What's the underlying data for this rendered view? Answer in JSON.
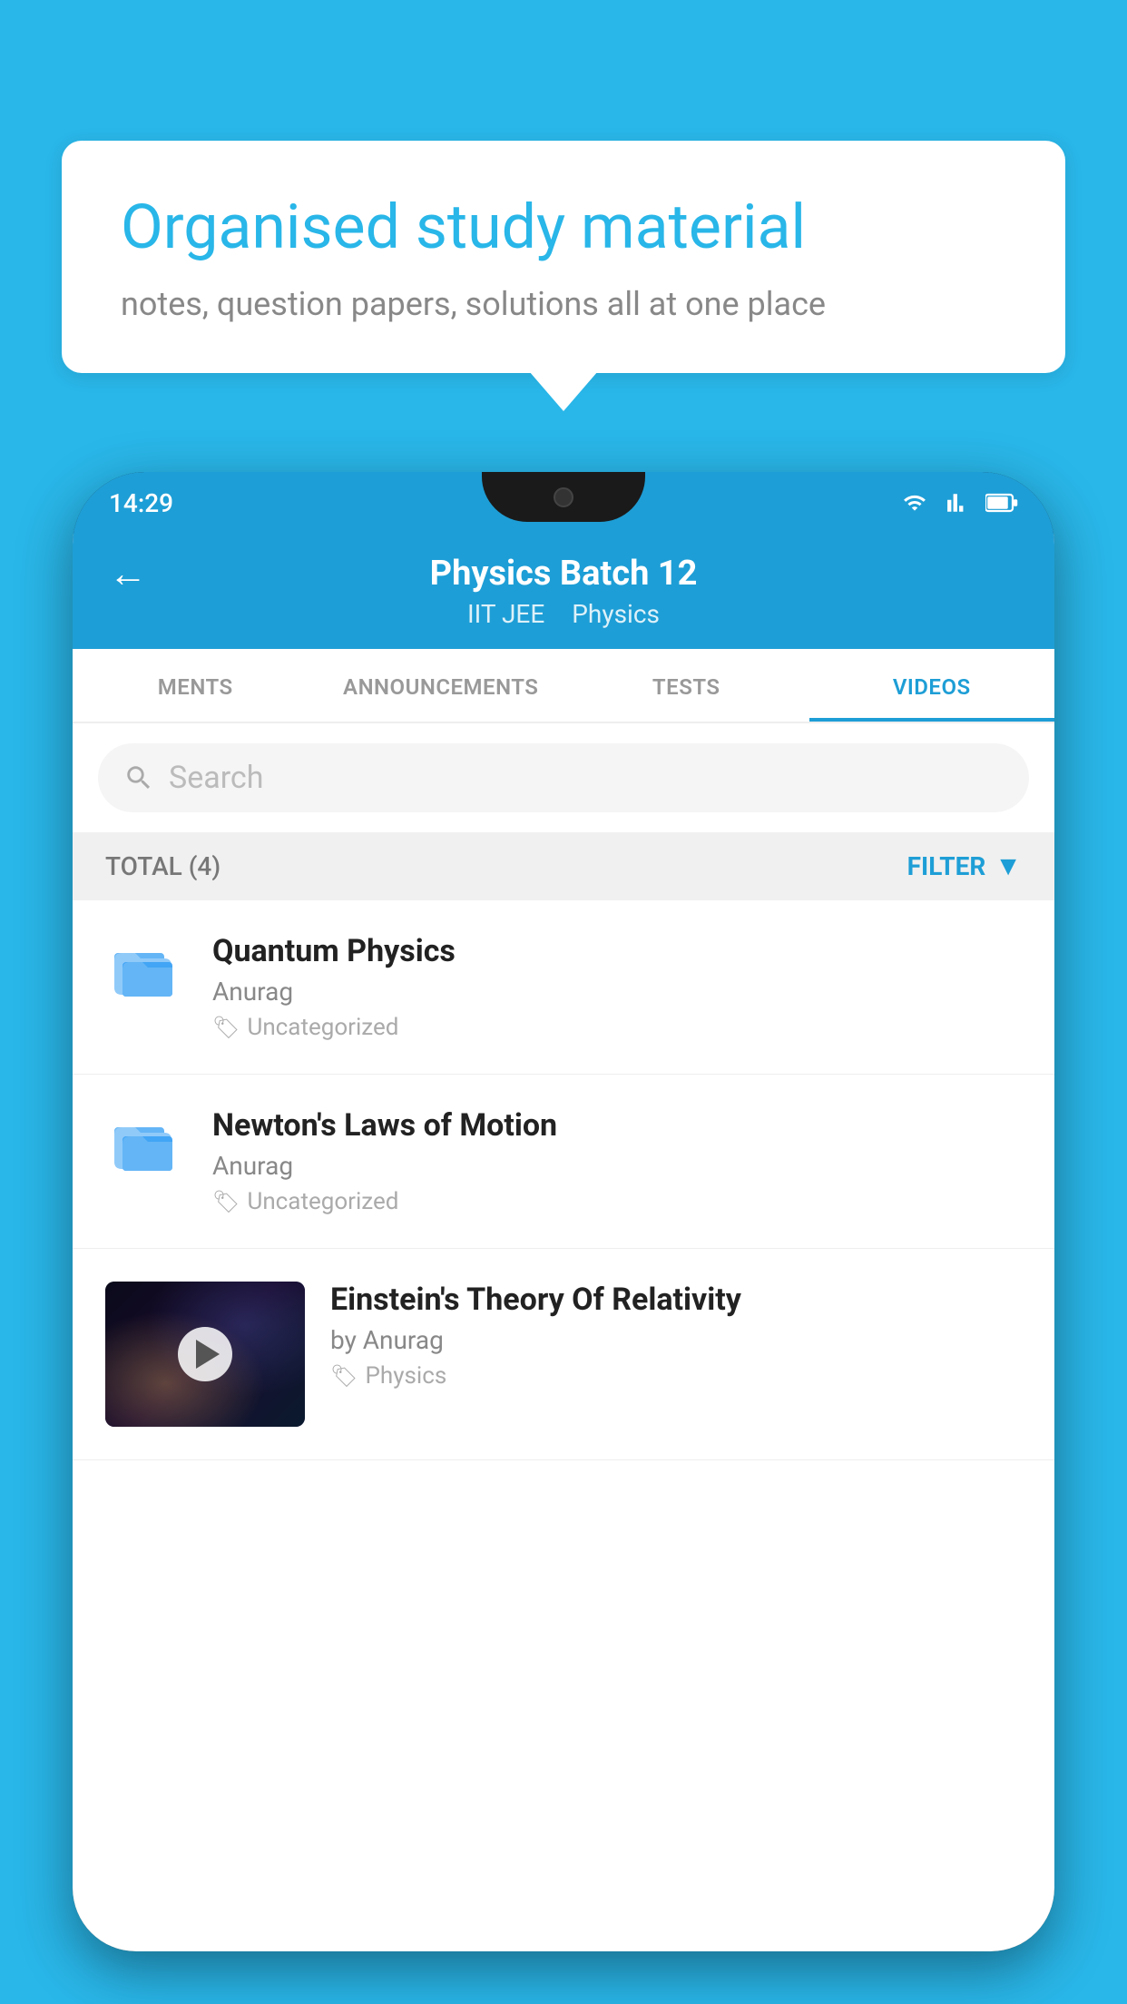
{
  "background_color": "#29b6e8",
  "bubble": {
    "title": "Organised study material",
    "subtitle": "notes, question papers, solutions all at one place"
  },
  "status_bar": {
    "time": "14:29"
  },
  "header": {
    "back_label": "←",
    "title": "Physics Batch 12",
    "tag1": "IIT JEE",
    "tag2": "Physics"
  },
  "tabs": [
    {
      "label": "MENTS",
      "active": false
    },
    {
      "label": "ANNOUNCEMENTS",
      "active": false
    },
    {
      "label": "TESTS",
      "active": false
    },
    {
      "label": "VIDEOS",
      "active": true
    }
  ],
  "search": {
    "placeholder": "Search"
  },
  "filter": {
    "total_label": "TOTAL (4)",
    "filter_label": "FILTER"
  },
  "videos": [
    {
      "title": "Quantum Physics",
      "author": "Anurag",
      "category": "Uncategorized",
      "has_thumbnail": false
    },
    {
      "title": "Newton's Laws of Motion",
      "author": "Anurag",
      "category": "Uncategorized",
      "has_thumbnail": false
    },
    {
      "title": "Einstein's Theory Of Relativity",
      "author": "by Anurag",
      "category": "Physics",
      "has_thumbnail": true
    }
  ]
}
